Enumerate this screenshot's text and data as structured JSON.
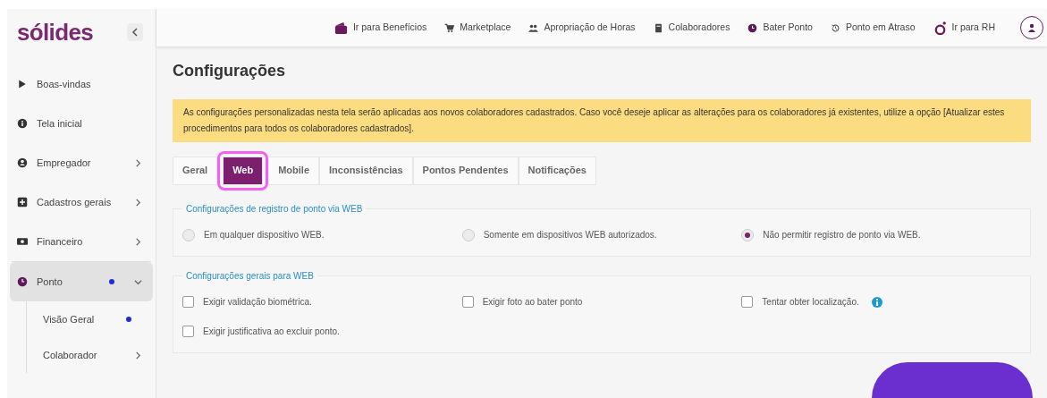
{
  "sidebar": {
    "logo": "sólides",
    "items": [
      {
        "label": "Boas-vindas",
        "has_chevron": false,
        "dot": false,
        "selected": false
      },
      {
        "label": "Tela inicial",
        "has_chevron": false,
        "dot": false,
        "selected": false
      },
      {
        "label": "Empregador",
        "has_chevron": true,
        "dot": false,
        "selected": false
      },
      {
        "label": "Cadastros gerais",
        "has_chevron": true,
        "dot": false,
        "selected": false
      },
      {
        "label": "Financeiro",
        "has_chevron": true,
        "dot": false,
        "selected": false
      },
      {
        "label": "Ponto",
        "has_chevron": true,
        "dot": true,
        "selected": true,
        "children": [
          {
            "label": "Visão Geral",
            "has_chevron": false,
            "dot": true
          },
          {
            "label": "Colaborador",
            "has_chevron": true,
            "dot": false
          }
        ]
      }
    ]
  },
  "top_bar": {
    "links": [
      {
        "label": "Ir para Benefícios"
      },
      {
        "label": "Marketplace"
      },
      {
        "label": "Apropriação de Horas"
      },
      {
        "label": "Colaboradores"
      },
      {
        "label": "Bater Ponto"
      },
      {
        "label": "Ponto em Atraso"
      },
      {
        "label": "Ir para RH"
      }
    ]
  },
  "page": {
    "title": "Configurações",
    "alert": "As configurações personalizadas nesta tela serão aplicadas aos novos colaboradores cadastrados. Caso você deseje aplicar as alterações para os colaboradores já existentes, utilize a opção [Atualizar estes procedimentos para todos os colaboradores cadastrados].",
    "tabs": [
      {
        "label": "Geral",
        "selected": false,
        "highlighted": false
      },
      {
        "label": "Web",
        "selected": true,
        "highlighted": true
      },
      {
        "label": "Mobile",
        "selected": false,
        "highlighted": false
      },
      {
        "label": "Inconsistências",
        "selected": false,
        "highlighted": false
      },
      {
        "label": "Pontos Pendentes",
        "selected": false,
        "highlighted": false
      },
      {
        "label": "Notificações",
        "selected": false,
        "highlighted": false
      }
    ],
    "sections": [
      {
        "legend": "Configurações de registro de ponto via WEB",
        "options": [
          {
            "kind": "radio",
            "label": "Em qualquer dispositivo WEB.",
            "selected": false,
            "info": false
          },
          {
            "kind": "radio",
            "label": "Somente em dispositivos WEB autorizados.",
            "selected": false,
            "info": false
          },
          {
            "kind": "radio",
            "label": "Não permitir registro de ponto via WEB.",
            "selected": true,
            "info": false
          }
        ]
      },
      {
        "legend": "Configurações gerais para WEB",
        "options": [
          {
            "kind": "checkbox",
            "label": "Exigir validação biométrica.",
            "checked": false,
            "info": false
          },
          {
            "kind": "checkbox",
            "label": "Exigir foto ao bater ponto",
            "checked": false,
            "info": false
          },
          {
            "kind": "checkbox",
            "label": "Tentar obter localização.",
            "checked": false,
            "info": true
          },
          {
            "kind": "checkbox",
            "label": "Exigir justificativa ao excluir ponto.",
            "checked": false,
            "info": false
          }
        ]
      }
    ]
  }
}
